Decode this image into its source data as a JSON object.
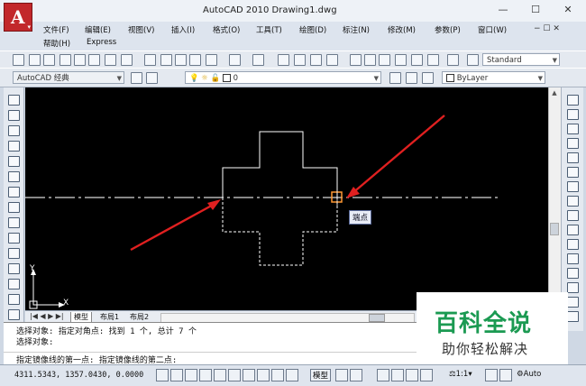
{
  "window": {
    "title": "AutoCAD 2010    Drawing1.dwg",
    "min_glyph": "—",
    "max_glyph": "☐",
    "close_glyph": "✕",
    "doc_controls": "− ☐ ✕",
    "logo_letter": "A",
    "logo_menu_glyph": "▾"
  },
  "menu": {
    "row1": [
      "文件(F)",
      "编辑(E)",
      "视图(V)",
      "插入(I)",
      "格式(O)",
      "工具(T)",
      "绘图(D)",
      "标注(N)",
      "修改(M)",
      "参数(P)",
      "窗口(W)"
    ],
    "row2": [
      "帮助(H)",
      "Express"
    ]
  },
  "toolbar": {
    "text_style": "Standard",
    "workspace": "AutoCAD 经典",
    "layer": "0",
    "color": "ByLayer"
  },
  "canvas": {
    "tooltip": "端点",
    "ucs_x": "X",
    "ucs_y": "Y"
  },
  "layout_tabs": {
    "nav": "|◀ ◀ ▶ ▶|",
    "tabs": [
      "模型",
      "布局1",
      "布局2"
    ]
  },
  "command": {
    "lines": [
      "选择对象: 指定对角点: 找到 1 个, 总计 7 个",
      "选择对象:",
      "指定镜像线的第一点: 指定镜像线的第二点:"
    ]
  },
  "status": {
    "coords": "4311.5343,  1357.0430,  0.0000",
    "model_label": "模型",
    "scale": "1:1",
    "auto": "Auto"
  },
  "watermark": {
    "title": "百科全说",
    "subtitle": "助你轻松解决"
  },
  "colors": {
    "canvas_bg": "#000000",
    "shape_line": "#ffffff",
    "center_line": "#d8d8d8",
    "arrow": "#e02020",
    "snap_marker": "#ff9933",
    "watermark_green": "#1b9a52"
  }
}
